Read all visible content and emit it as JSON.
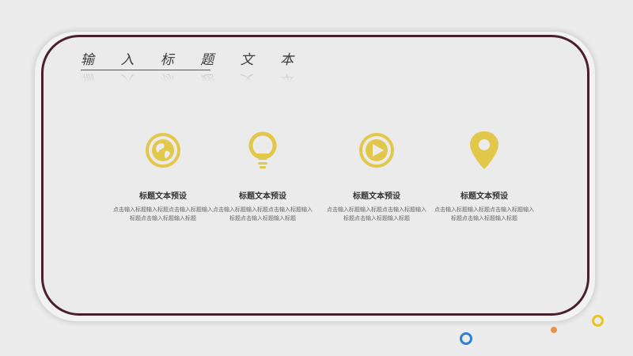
{
  "slide": {
    "title": "输 入 标 题 文 本",
    "colors": {
      "accent": "#e2c84a",
      "frame_border": "#4a1f2c",
      "background": "#ececec",
      "dot_blue": "#2f7fd6",
      "dot_orange": "#e8924a",
      "dot_yellow": "#e6c42a"
    }
  },
  "features": [
    {
      "icon": "globe-icon",
      "title": "标题文本预设",
      "desc": "点击输入标题输入标题点击输入标题输入标题点击输入标题输入标题"
    },
    {
      "icon": "lightbulb-icon",
      "title": "标题文本预设",
      "desc": "点击输入标题输入标题点击输入标题输入标题点击输入标题输入标题"
    },
    {
      "icon": "play-icon",
      "title": "标题文本预设",
      "desc": "点击输入标题输入标题点击输入标题输入标题点击输入标题输入标题"
    },
    {
      "icon": "location-pin-icon",
      "title": "标题文本预设",
      "desc": "点击输入标题输入标题点击输入标题输入标题点击输入标题输入标题"
    }
  ]
}
